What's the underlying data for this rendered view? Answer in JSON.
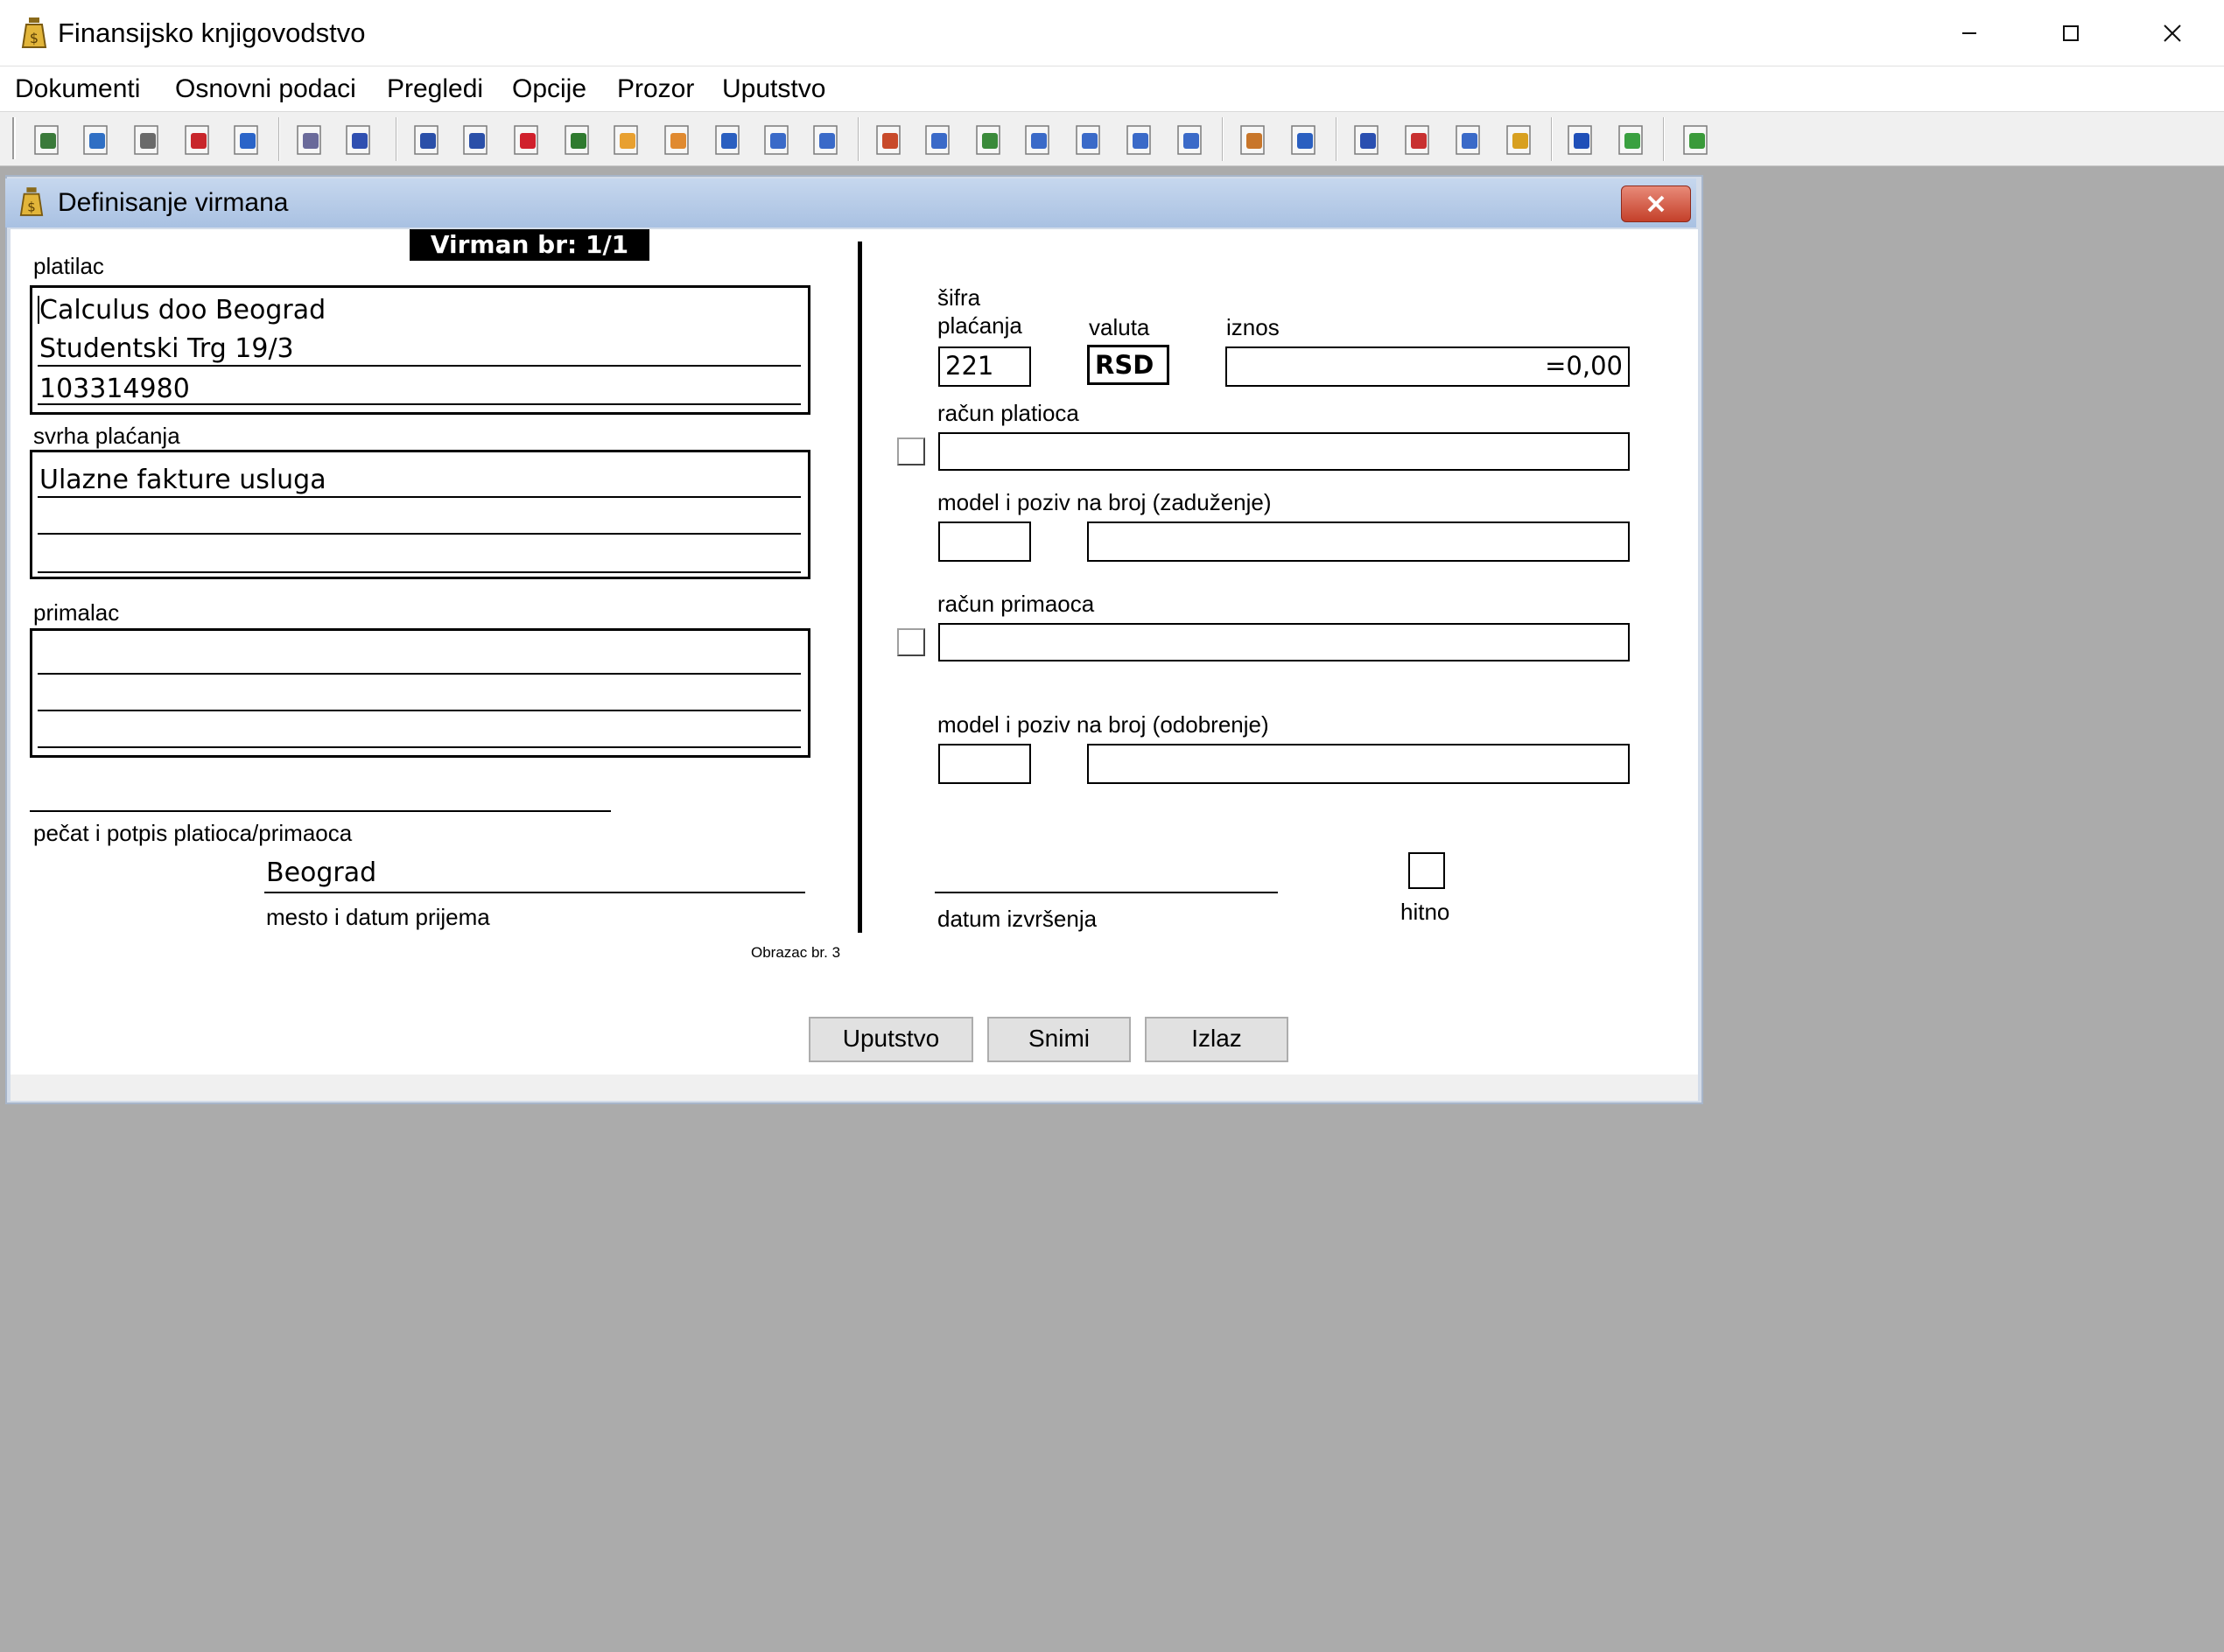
{
  "window": {
    "title": "Finansijsko knjigovodstvo",
    "icons": {
      "app": "money-bag-icon",
      "minimize": "minimize-icon",
      "maximize": "maximize-icon",
      "close": "close-icon"
    }
  },
  "menu": {
    "items": [
      {
        "label": "Dokumenti"
      },
      {
        "label": "Osnovni podaci"
      },
      {
        "label": "Pregledi"
      },
      {
        "label": "Opcije"
      },
      {
        "label": "Prozor"
      },
      {
        "label": "Uputstvo"
      }
    ]
  },
  "toolbar": {
    "buttons": [
      {
        "icon": "ledger-icon",
        "color": "#3a7a3a"
      },
      {
        "icon": "refresh-document-icon",
        "color": "#2f6fc4"
      },
      {
        "icon": "sum-document-icon",
        "color": "#6a6a6a"
      },
      {
        "icon": "red-document-icon",
        "color": "#c8262b"
      },
      {
        "icon": "folder-open-icon",
        "color": "#2a64c8"
      },
      {
        "icon": "gears-icon",
        "color": "#6a6a9a"
      },
      {
        "icon": "db-document-icon",
        "color": "#2f4fb0"
      },
      {
        "icon": "info-document-icon",
        "color": "#2a4fa8"
      },
      {
        "icon": "branch-icon",
        "color": "#2a4fa8"
      },
      {
        "icon": "red-gem-icon",
        "color": "#d0202c"
      },
      {
        "icon": "org-chart-icon",
        "color": "#2f7a2f"
      },
      {
        "icon": "user-green-icon",
        "color": "#e8a030"
      },
      {
        "icon": "user-blue-icon",
        "color": "#e08a30"
      },
      {
        "icon": "tree-icon",
        "color": "#2a5fc0"
      },
      {
        "icon": "money-document-icon",
        "color": "#3a6ac8"
      },
      {
        "icon": "grid-document-icon",
        "color": "#3a6ac8"
      },
      {
        "icon": "printer-stack-icon",
        "color": "#c84a2a"
      },
      {
        "icon": "copy-windows-icon",
        "color": "#3a6ac8"
      },
      {
        "icon": "import-icon",
        "color": "#3a8a3a"
      },
      {
        "icon": "windows-cascade-icon",
        "color": "#3a6ac8"
      },
      {
        "icon": "export-icon",
        "color": "#3a6ac8"
      },
      {
        "icon": "table-icon",
        "color": "#3a6ac8"
      },
      {
        "icon": "calc-window-icon",
        "color": "#3a6ac8"
      },
      {
        "icon": "clipboard-icon",
        "color": "#c8762a"
      },
      {
        "icon": "percent-icon",
        "color": "#2a5fc0"
      },
      {
        "icon": "spreadsheet-icon",
        "color": "#2a4fb0"
      },
      {
        "icon": "line-chart-icon",
        "color": "#c83030"
      },
      {
        "icon": "list-arrows-icon",
        "color": "#3a6ac8"
      },
      {
        "icon": "archive-icon",
        "color": "#d8a020"
      },
      {
        "icon": "help-icon",
        "color": "#1f4fb8"
      },
      {
        "icon": "globe-icon",
        "color": "#3aa040"
      },
      {
        "icon": "exit-icon",
        "color": "#3a9a3a"
      }
    ]
  },
  "child_window": {
    "title": "Definisanje virmana",
    "icons": {
      "app": "money-bag-icon",
      "close": "close-icon"
    }
  },
  "form": {
    "virman_no": "Virman br: 1/1",
    "platilac": {
      "label": "platilac",
      "lines": [
        "Calculus doo Beograd",
        "Studentski Trg 19/3",
        "103314980"
      ]
    },
    "svrha": {
      "label": "svrha plaćanja",
      "lines": [
        "Ulazne fakture usluga",
        "",
        ""
      ]
    },
    "primalac": {
      "label": "primalac",
      "lines": [
        "",
        "",
        ""
      ]
    },
    "pecat_label": "pečat i potpis platioca/primaoca",
    "mesto": {
      "value": "Beograd",
      "label": "mesto i datum prijema"
    },
    "obrazac": "Obrazac br. 3",
    "sifra": {
      "label_line1": "šifra",
      "label_line2": "plaćanja",
      "value": "221"
    },
    "valuta": {
      "label": "valuta",
      "value": "RSD"
    },
    "iznos": {
      "label": "iznos",
      "value": "=0,00"
    },
    "racun_platioca": {
      "label": "račun platioca",
      "value": ""
    },
    "model_zaduzenje": {
      "label": "model i poziv na broj (zaduženje)",
      "model": "",
      "poziv": ""
    },
    "racun_primaoca": {
      "label": "račun primaoca",
      "value": ""
    },
    "model_odobrenje": {
      "label": "model i poziv na broj (odobrenje)",
      "model": "",
      "poziv": ""
    },
    "datum_izvrsenja": {
      "label": "datum izvršenja",
      "value": ""
    },
    "hitno": {
      "label": "hitno",
      "checked": false
    }
  },
  "buttons": {
    "uputstvo": "Uputstvo",
    "snimi": "Snimi",
    "izlaz": "Izlaz"
  }
}
